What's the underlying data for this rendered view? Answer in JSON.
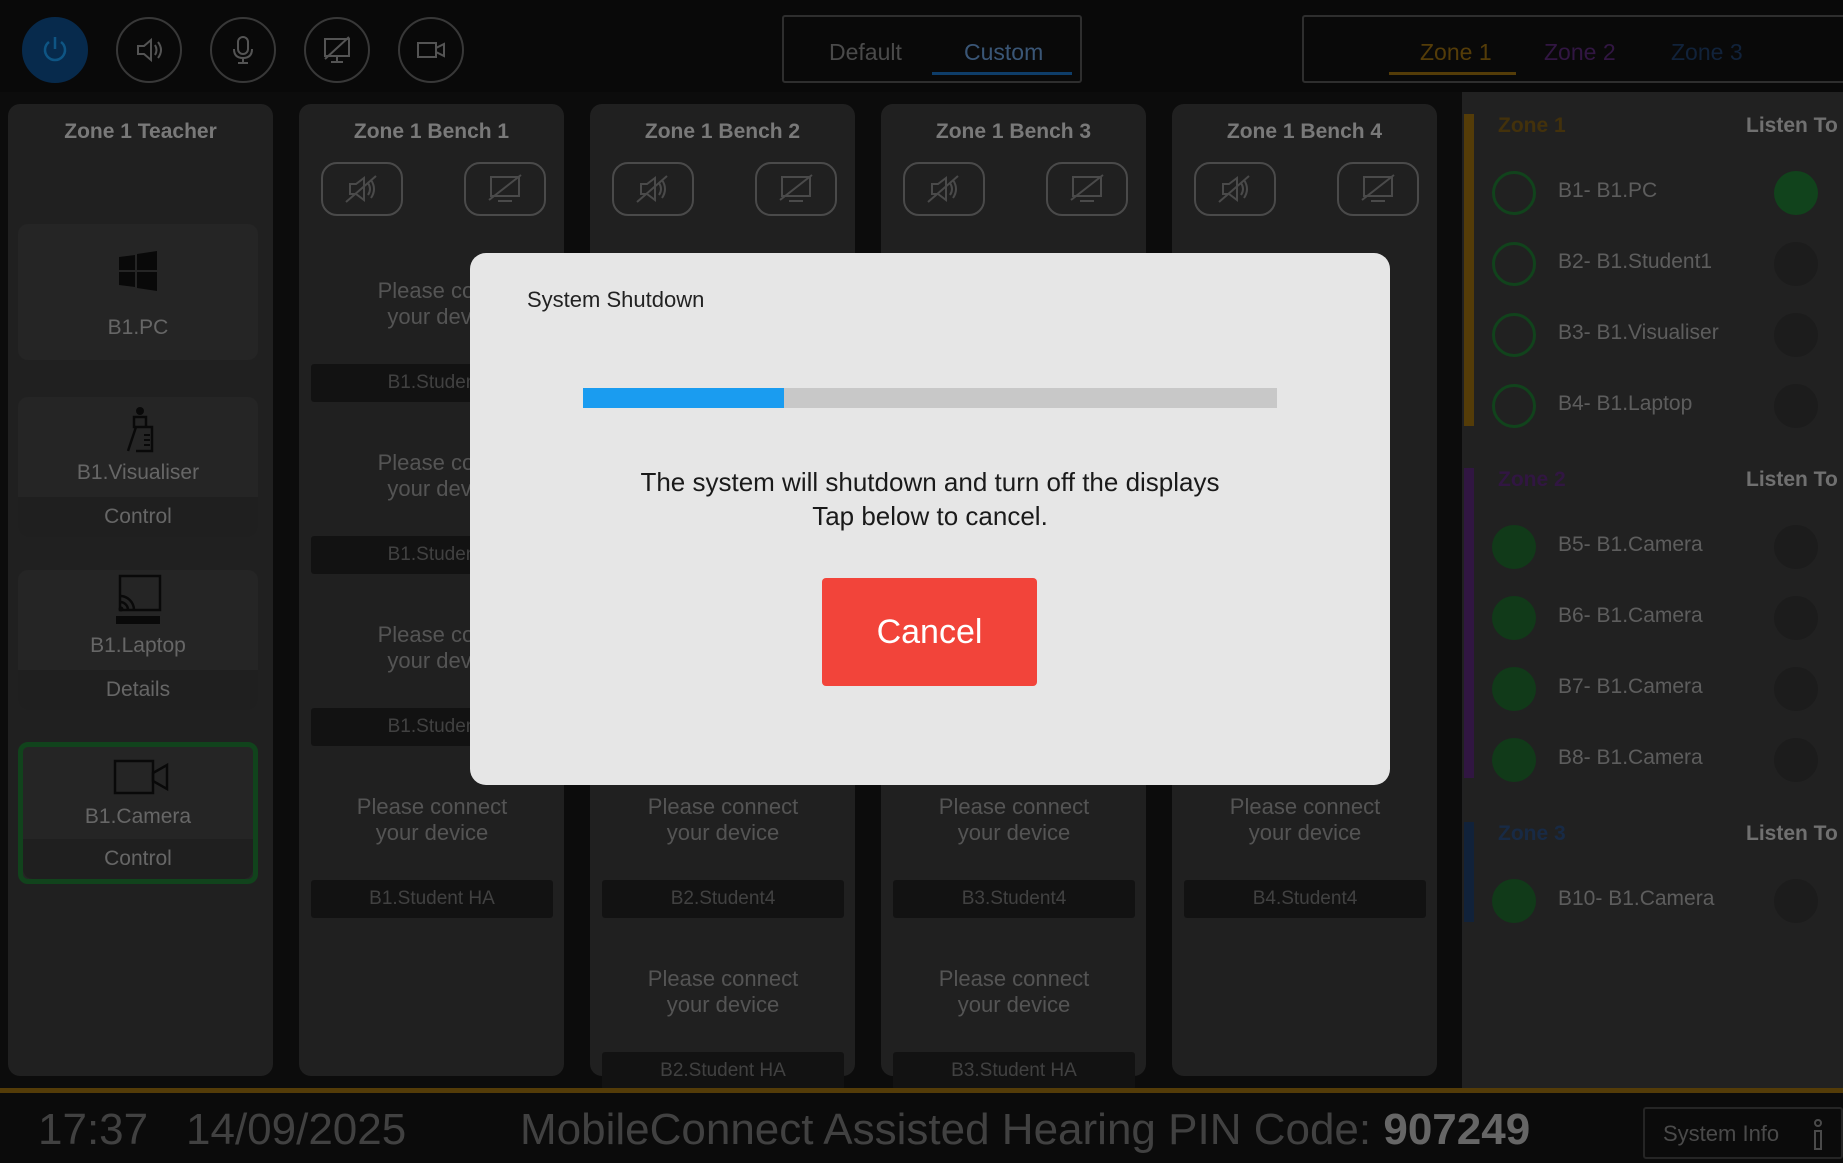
{
  "topbar": {
    "icons": [
      "power-icon",
      "speaker-icon",
      "microphone-icon",
      "display-icon",
      "camera-icon"
    ],
    "view_modes": [
      "Default",
      "Custom"
    ],
    "active_view": "Custom",
    "zone_tabs": [
      "Zone 1",
      "Zone 2",
      "Zone 3"
    ],
    "active_zone_tab": "Zone 1"
  },
  "colors": {
    "accent": "#1a9cf0",
    "zone1": "#d9a01e",
    "zone2": "#8e3ab1",
    "zone3": "#3e78c8",
    "green": "#1f7a33",
    "cancel": "#f2443a"
  },
  "teacher": {
    "title": "Zone 1 Teacher",
    "cards": [
      {
        "label": "B1.PC",
        "sub": "",
        "icon": "windows-icon"
      },
      {
        "label": "B1.Visualiser",
        "sub": "Control",
        "icon": "visualiser-icon"
      },
      {
        "label": "B1.Laptop",
        "sub": "Details",
        "icon": "cast-icon"
      },
      {
        "label": "B1.Camera",
        "sub": "Control",
        "icon": "camera-icon",
        "selected": true
      }
    ]
  },
  "benches": [
    {
      "title": "Zone 1 Bench 1",
      "slots": [
        {
          "msg1": "Please con",
          "msg2": "your devi",
          "name": "B1.Studen"
        },
        {
          "msg1": "Please con",
          "msg2": "your devi",
          "name": "B1.Studen"
        },
        {
          "msg1": "Please con",
          "msg2": "your devi",
          "name": "B1.Studen"
        },
        {
          "msg1": "Please connect",
          "msg2": "your device",
          "name": "B1.Student HA"
        }
      ]
    },
    {
      "title": "Zone 1 Bench 2",
      "slots": [
        {
          "msg1": "Please connect",
          "msg2": "your device",
          "name": "B2.Student4"
        },
        {
          "msg1": "Please connect",
          "msg2": "your device",
          "name": "B2.Student HA"
        }
      ]
    },
    {
      "title": "Zone 1 Bench 3",
      "slots": [
        {
          "msg1": "Please connect",
          "msg2": "your device",
          "name": "B3.Student4"
        },
        {
          "msg1": "Please connect",
          "msg2": "your device",
          "name": "B3.Student HA"
        }
      ]
    },
    {
      "title": "Zone 1 Bench 4",
      "slots": [
        {
          "msg1": "Please connect",
          "msg2": "your device",
          "name": "B4.Student4"
        }
      ]
    }
  ],
  "right_panel": {
    "listen_label": "Listen To",
    "zones": [
      {
        "name": "Zone 1",
        "sources": [
          {
            "label": "B1- B1.PC",
            "active": false,
            "listen": true
          },
          {
            "label": "B2- B1.Student1",
            "active": false,
            "listen": false
          },
          {
            "label": "B3- B1.Visualiser",
            "active": false,
            "listen": false
          },
          {
            "label": "B4- B1.Laptop",
            "active": false,
            "listen": false
          }
        ]
      },
      {
        "name": "Zone 2",
        "sources": [
          {
            "label": "B5- B1.Camera",
            "active": true,
            "listen": false
          },
          {
            "label": "B6- B1.Camera",
            "active": true,
            "listen": false
          },
          {
            "label": "B7- B1.Camera",
            "active": true,
            "listen": false
          },
          {
            "label": "B8- B1.Camera",
            "active": true,
            "listen": false
          }
        ]
      },
      {
        "name": "Zone 3",
        "sources": [
          {
            "label": "B10- B1.Camera",
            "active": true,
            "listen": false
          }
        ]
      }
    ]
  },
  "footer": {
    "time": "17:37",
    "date": "14/09/2025",
    "pin_label": "MobileConnect Assisted Hearing PIN Code:",
    "pin_code": "907249",
    "system_info": "System Info"
  },
  "modal": {
    "title": "System Shutdown",
    "progress": 0.29,
    "line1": "The system will shutdown and turn off the displays",
    "line2": "Tap below to cancel.",
    "cancel_label": "Cancel"
  }
}
